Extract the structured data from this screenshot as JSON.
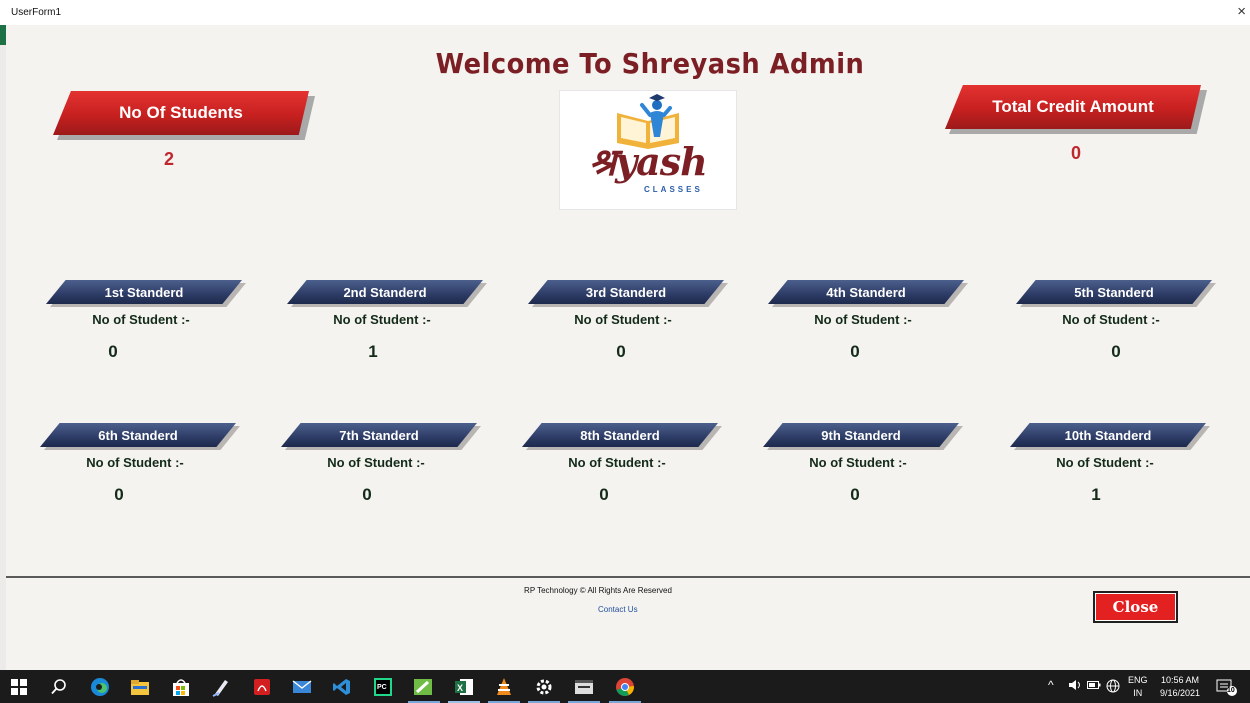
{
  "window": {
    "title": "UserForm1",
    "close_glyph": "×"
  },
  "header": {
    "welcome": "Welcome To Shreyash Admin"
  },
  "students_card": {
    "label": "No Of Students",
    "value": "2"
  },
  "credit_card": {
    "label": "Total Credit Amount",
    "value": "0"
  },
  "logo": {
    "script_text": "श्रyash",
    "sub_text": "CLASSES"
  },
  "standards": [
    {
      "label": "1st Standerd",
      "caption": "No of Student :-",
      "count": "0"
    },
    {
      "label": "2nd Standerd",
      "caption": "No of Student :-",
      "count": "1"
    },
    {
      "label": "3rd Standerd",
      "caption": "No of Student :-",
      "count": "0"
    },
    {
      "label": "4th Standerd",
      "caption": "No of Student :-",
      "count": "0"
    },
    {
      "label": "5th Standerd",
      "caption": "No of Student :-",
      "count": "0"
    },
    {
      "label": "6th Standerd",
      "caption": "No of Student :-",
      "count": "0"
    },
    {
      "label": "7th Standerd",
      "caption": "No of Student :-",
      "count": "0"
    },
    {
      "label": "8th Standerd",
      "caption": "No of Student :-",
      "count": "0"
    },
    {
      "label": "9th Standerd",
      "caption": "No of Student :-",
      "count": "0"
    },
    {
      "label": "10th Standerd",
      "caption": "No of Student :-",
      "count": "1"
    }
  ],
  "footer": {
    "copyright": "RP Technology © All Rights Are Reserved",
    "contact": "Contact Us",
    "close_label": "Close"
  },
  "taskbar": {
    "icons": [
      "windows-start-icon",
      "search-icon",
      "edge-browser-icon",
      "file-explorer-icon",
      "store-icon",
      "pen-app-icon",
      "pdf-reader-icon",
      "mail-icon",
      "vscode-icon",
      "pycharm-icon",
      "notepad-plus-icon",
      "excel-icon",
      "vlc-icon",
      "settings-icon",
      "window-app-icon",
      "chrome-icon"
    ],
    "lang_top": "ENG",
    "lang_bottom": "IN",
    "time": "10:56 AM",
    "date": "9/16/2021",
    "notifications": "10"
  },
  "colors": {
    "accent_red": "#c72020",
    "title_maroon": "#7b1f24",
    "pill_navy": "#2d3c66"
  }
}
